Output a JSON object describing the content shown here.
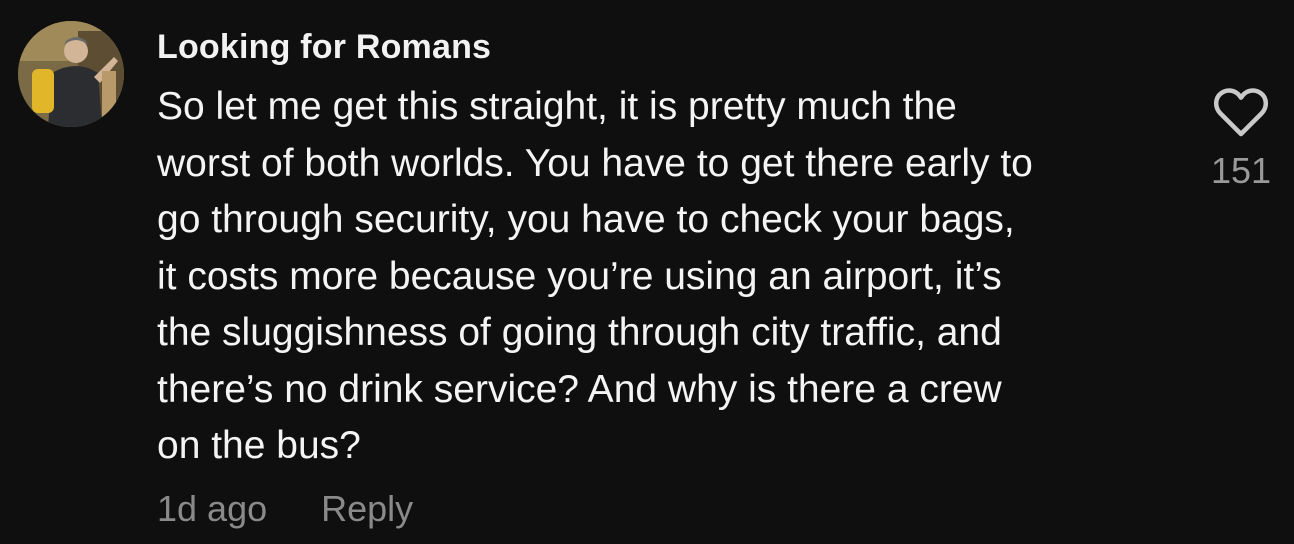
{
  "comment": {
    "username": "Looking for Romans",
    "text": "So let me get this straight, it is pretty much the\nworst of both worlds. You have to get there early to\ngo through security, you have to check your bags,\nit costs more because you’re using an airport, it’s\nthe sluggishness of going through city traffic, and\nthere’s no drink service? And why is there a crew\non the bus?",
    "timestamp": "1d ago",
    "reply_label": "Reply",
    "like_count": "151"
  },
  "icons": {
    "like": "heart-outline-icon",
    "avatar": "user-avatar-photo"
  },
  "colors": {
    "background": "#0f0f0f",
    "text": "#f4f4f4",
    "secondary": "#8a8a8a"
  }
}
